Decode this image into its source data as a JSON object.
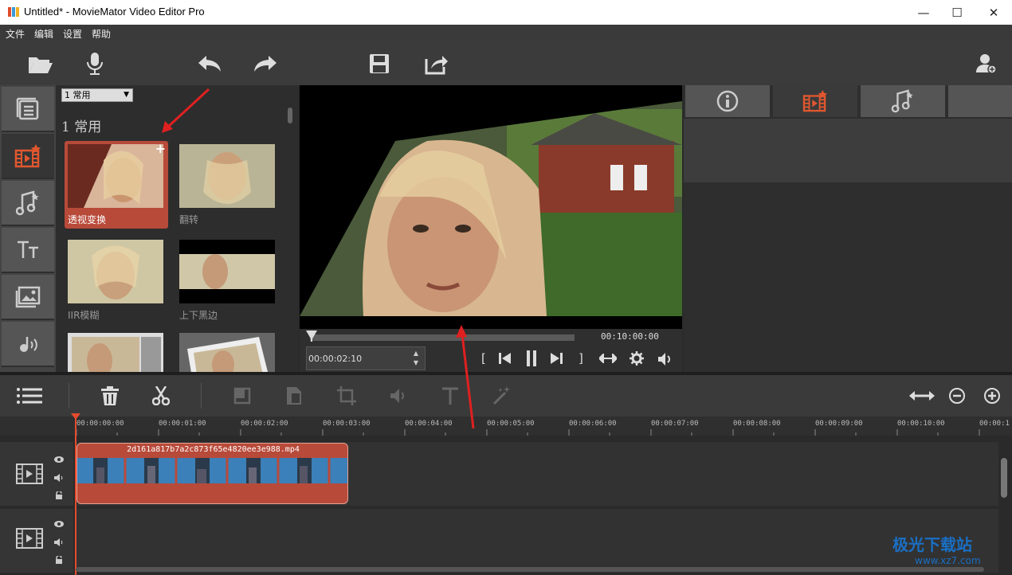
{
  "window": {
    "title": "Untitled* - MovieMator Video Editor Pro",
    "minimize": "—",
    "maximize": "☐",
    "close": "✕"
  },
  "menu": {
    "file": "文件",
    "edit": "编辑",
    "settings": "设置",
    "help": "帮助"
  },
  "filters": {
    "category_select": "1 常用",
    "category_heading": "1  常用",
    "items": [
      {
        "label": "透视变换",
        "selected": true
      },
      {
        "label": "翻转"
      },
      {
        "label": "IIR模糊"
      },
      {
        "label": "上下黑边"
      },
      {
        "label": ""
      },
      {
        "label": ""
      }
    ],
    "add_glyph": "+"
  },
  "player": {
    "total_time": "00:10:00:00",
    "current_time": "00:00:02:10",
    "spin_up": "▲",
    "spin_down": "▼",
    "mark_in": "[",
    "mark_out": "]"
  },
  "timeline": {
    "ruler": [
      "00:00:00:00",
      "00:00:01:00",
      "00:00:02:00",
      "00:00:03:00",
      "00:00:04:00",
      "00:00:05:00",
      "00:00:06:00",
      "00:00:07:00",
      "00:00:08:00",
      "00:00:09:00",
      "00:00:10:00",
      "00:00:1"
    ],
    "clip_name": "2d161a817b7a2c873f65e4820ee3e988.mp4"
  },
  "watermark": {
    "name": "极光下载站",
    "url": "www.xz7.com"
  },
  "colors": {
    "accent": "#b84a3a",
    "active_icon": "#e0572f",
    "arrow": "#e02020"
  }
}
